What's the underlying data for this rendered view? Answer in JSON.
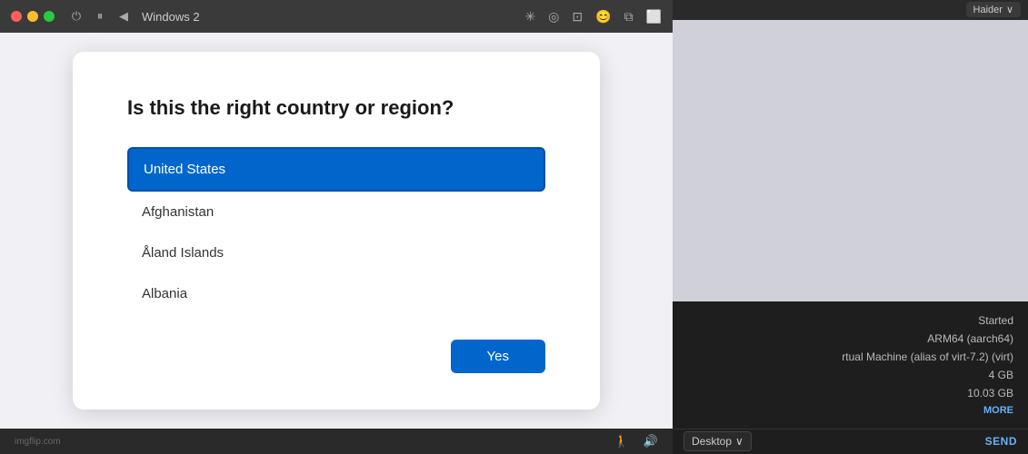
{
  "window": {
    "title": "Windows 2"
  },
  "titlebar": {
    "left_icons": [
      "⏻",
      "⏸",
      "◀"
    ],
    "right_icons": [
      "✳",
      "◎",
      "⊡",
      "😊",
      "⧉",
      "⬜"
    ]
  },
  "dialog": {
    "question": "Is this the right country or region?",
    "countries": [
      {
        "name": "United States",
        "selected": true
      },
      {
        "name": "Afghanistan",
        "selected": false
      },
      {
        "name": "Åland Islands",
        "selected": false
      },
      {
        "name": "Albania",
        "selected": false
      }
    ],
    "confirm_button": "Yes"
  },
  "bottombar": {
    "watermark": "imgflip.com"
  },
  "info_panel": {
    "rows": [
      {
        "value": "Started"
      },
      {
        "value": "ARM64 (aarch64)"
      },
      {
        "value": "rtual Machine (alias of virt-7.2) (virt)"
      },
      {
        "value": "4 GB"
      },
      {
        "value": "10.03 GB"
      }
    ],
    "more_button": "MORE"
  },
  "footer": {
    "desktop_label": "Desktop",
    "send_label": "SEND"
  },
  "top_right": {
    "folder_label": "Haider",
    "chevron": "∨"
  }
}
